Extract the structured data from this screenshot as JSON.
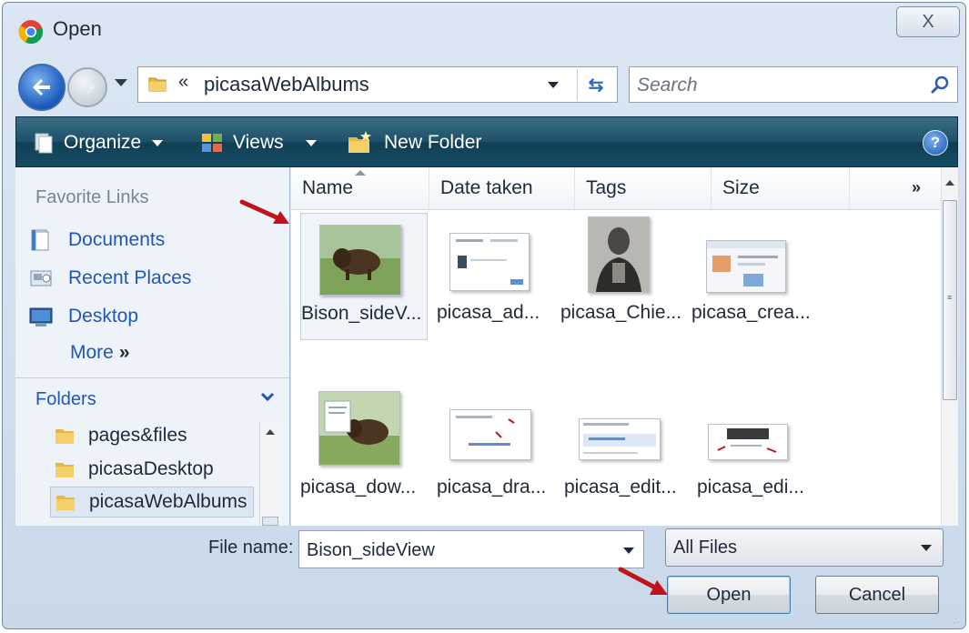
{
  "window": {
    "title": "Open",
    "close_label": "X"
  },
  "address_bar": {
    "chevron": "«",
    "path": "picasaWebAlbums"
  },
  "search": {
    "placeholder": "Search"
  },
  "toolbar": {
    "organize_label": "Organize",
    "views_label": "Views",
    "new_folder_label": "New Folder",
    "help_label": "?"
  },
  "nav_pane": {
    "favorites_header": "Favorite Links",
    "favorites": [
      {
        "label": "Documents",
        "icon": "documents-icon"
      },
      {
        "label": "Recent Places",
        "icon": "recent-places-icon"
      },
      {
        "label": "Desktop",
        "icon": "desktop-icon"
      }
    ],
    "more_label": "More",
    "more_chevron": "»",
    "folders_header": "Folders",
    "folders": [
      {
        "label": "pages&files",
        "selected": false
      },
      {
        "label": "picasaDesktop",
        "selected": false
      },
      {
        "label": "picasaWebAlbums",
        "selected": true
      }
    ]
  },
  "file_list": {
    "columns": [
      "Name",
      "Date taken",
      "Tags",
      "Size"
    ],
    "more_columns": "»",
    "files": [
      {
        "label": "Bison_sideV...",
        "thumb": "bison-photo",
        "selected": true
      },
      {
        "label": "picasa_ad...",
        "thumb": "screenshot",
        "selected": false
      },
      {
        "label": "picasa_Chie...",
        "thumb": "portrait-photo",
        "selected": false
      },
      {
        "label": "picasa_crea...",
        "thumb": "screenshot",
        "selected": false
      },
      {
        "label": "picasa_dow...",
        "thumb": "bison-screenshot",
        "selected": false
      },
      {
        "label": "picasa_dra...",
        "thumb": "screenshot",
        "selected": false
      },
      {
        "label": "picasa_edit...",
        "thumb": "screenshot",
        "selected": false
      },
      {
        "label": "picasa_edi...",
        "thumb": "screenshot",
        "selected": false
      }
    ]
  },
  "bottom": {
    "filename_label": "File name:",
    "filename_value": "Bison_sideView",
    "filter_value": "All Files",
    "open_label": "Open",
    "cancel_label": "Cancel"
  },
  "colors": {
    "toolbar": "#1d5068",
    "link": "#1f57b8",
    "annotation_arrow": "#c0141c"
  }
}
